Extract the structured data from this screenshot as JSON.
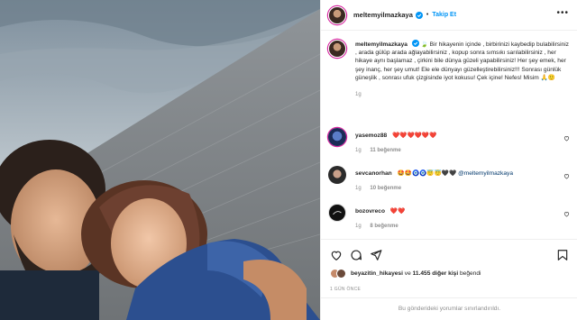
{
  "header": {
    "username": "meltemyilmazkaya",
    "dot": "•",
    "follow_label": "Takip Et",
    "more": "•••"
  },
  "caption": {
    "username": "meltemyilmazkaya",
    "text": "Bir hikayenin içinde , birbirinizi kaybedip bulabilirsiniz , arada gülüp arada ağlayabilirsiniz , kopup sonra sımsıkı sarılabilirsiniz , her hikaye aynı başlamaz , çirkini bile dünya güzeli yapabilirsiniz! Her şey emek, her şey inanç, her şey umut! Ele ele dünyayı güzelleştirebilirsiniz!!! Sonrası günlük güneşlik , sonrası ufuk çizgisinde iyot kokusu! Çek içine! Nefes! Misim",
    "emoji_after_name": "🍃",
    "emoji_end": "🙏🙂",
    "time": "1g"
  },
  "comments": [
    {
      "username": "yasemoz88",
      "text": "❤️❤️❤️❤️❤️❤️",
      "time": "1g",
      "likes": "11 beğenme"
    },
    {
      "username": "sevcanorhan",
      "text": "🤩🤩🧿🧿😇😇🖤🖤",
      "mention": "@meltemyilmazkaya",
      "time": "1g",
      "likes": "10 beğenme"
    },
    {
      "username": "bozovreco",
      "text": "❤️❤️",
      "time": "1g",
      "likes": "8 beğenme"
    }
  ],
  "likes": {
    "first_user": "beyazitin_hikayesi",
    "connector": "ve",
    "others": "11.455 diğer kişi",
    "suffix": "beğendi"
  },
  "date": "1 GÜN ÖNCE",
  "comments_limited": "Bu gönderideki yorumlar sınırlandırıldı.",
  "colors": {
    "accent": "#0095f6",
    "heart": "#ed4956",
    "muted": "#8e8e8e",
    "text": "#262626"
  },
  "icons": [
    "verified-badge-icon",
    "heart-icon",
    "comment-icon",
    "share-icon",
    "bookmark-icon",
    "more-icon"
  ]
}
